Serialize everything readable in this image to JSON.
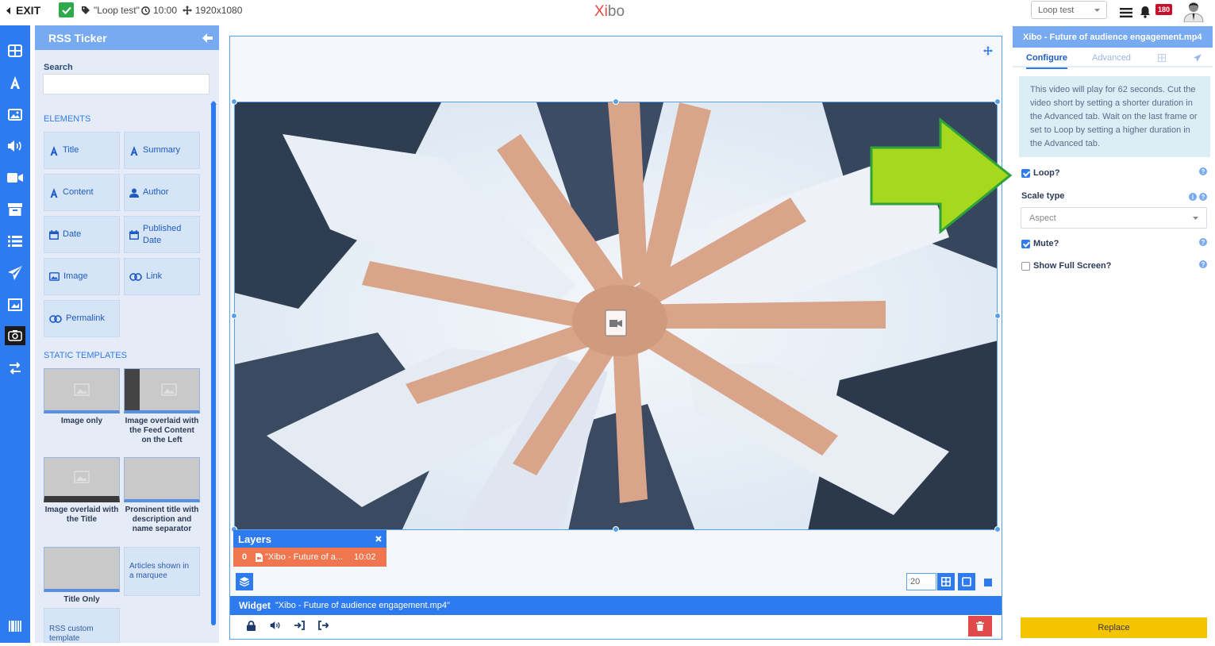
{
  "topbar": {
    "exit_label": "EXIT",
    "layout_name": "\"Loop test\"",
    "layout_duration": "10:00",
    "layout_resolution": "1920x1080",
    "logo_part1": "Xi",
    "logo_part2": "bo",
    "layout_select": "Loop test",
    "notification_count": "180"
  },
  "toolbox": {
    "title": "RSS Ticker",
    "search_label": "Search",
    "search_placeholder": "",
    "elements_heading": "ELEMENTS",
    "elements": {
      "title": "Title",
      "summary": "Summary",
      "content": "Content",
      "author": "Author",
      "date": "Date",
      "published_date": "Published Date",
      "image": "Image",
      "link": "Link",
      "permalink": "Permalink"
    },
    "templates_heading": "STATIC TEMPLATES",
    "templates": {
      "image_only": "Image only",
      "image_overlaid_left": "Image overlaid with the Feed Content on the Left",
      "image_overlaid_title": "Image overlaid with the Title",
      "prominent_title": "Prominent title with description and name separator",
      "title_only": "Title Only",
      "articles_marquee": "Articles shown in a marquee",
      "rss_custom": "RSS custom template"
    }
  },
  "viewer": {
    "layers_title": "Layers",
    "layer_index": "0",
    "layer_name": "\"Xibo - Future of a...",
    "layer_duration": "10:02",
    "zoom_value": "20",
    "widget_label": "Widget",
    "widget_name": "\"Xibo - Future of audience engagement.mp4\""
  },
  "properties": {
    "title": "Xibo - Future of audience engagement.mp4",
    "tab_configure": "Configure",
    "tab_advanced": "Advanced",
    "info_text": "This video will play for 62 seconds. Cut the video short by setting a shorter duration in the Advanced tab. Wait on the last frame or set to Loop by setting a higher duration in the Advanced tab.",
    "loop_label": "Loop?",
    "loop_checked": true,
    "scale_type_label": "Scale type",
    "scale_type_value": "Aspect",
    "mute_label": "Mute?",
    "mute_checked": true,
    "fullscreen_label": "Show Full Screen?",
    "fullscreen_checked": false,
    "replace_label": "Replace"
  },
  "colors": {
    "primary": "#2e7bf0",
    "panel_header": "#78aaf2",
    "layer_row": "#f0764f",
    "replace_button": "#f5c400",
    "annotation_arrow": "#a6d91e"
  }
}
